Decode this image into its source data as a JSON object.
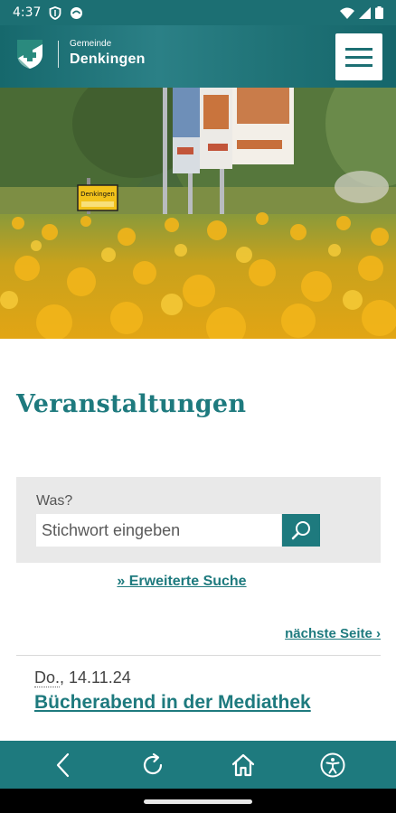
{
  "status_bar": {
    "time": "4:37",
    "icons": [
      "shield-status-icon",
      "app-status-icon",
      "wifi-icon",
      "signal-icon",
      "battery-icon"
    ]
  },
  "header": {
    "logo_small": "Gemeinde",
    "logo_big": "Denkingen",
    "menu_icon": "hamburger-icon"
  },
  "hero": {
    "town_sign": "Denkingen"
  },
  "main": {
    "title": "Veranstaltungen",
    "search": {
      "label": "Was?",
      "placeholder": "Stichwort eingeben",
      "value": "",
      "button_icon": "search-icon"
    },
    "advanced_search": "» Erweiterte Suche",
    "next_page": "nächste Seite ›",
    "events": [
      {
        "day": "Do.",
        "date": ", 14.11.24",
        "title": "Bücherabend in der Mediathek"
      }
    ]
  },
  "toolbar": {
    "icons": [
      "back-icon",
      "reload-icon",
      "home-icon",
      "accessibility-icon"
    ]
  },
  "colors": {
    "primary": "#1e7a7e",
    "status_bar": "#1c6f73",
    "search_bg": "#e9e9e9"
  }
}
